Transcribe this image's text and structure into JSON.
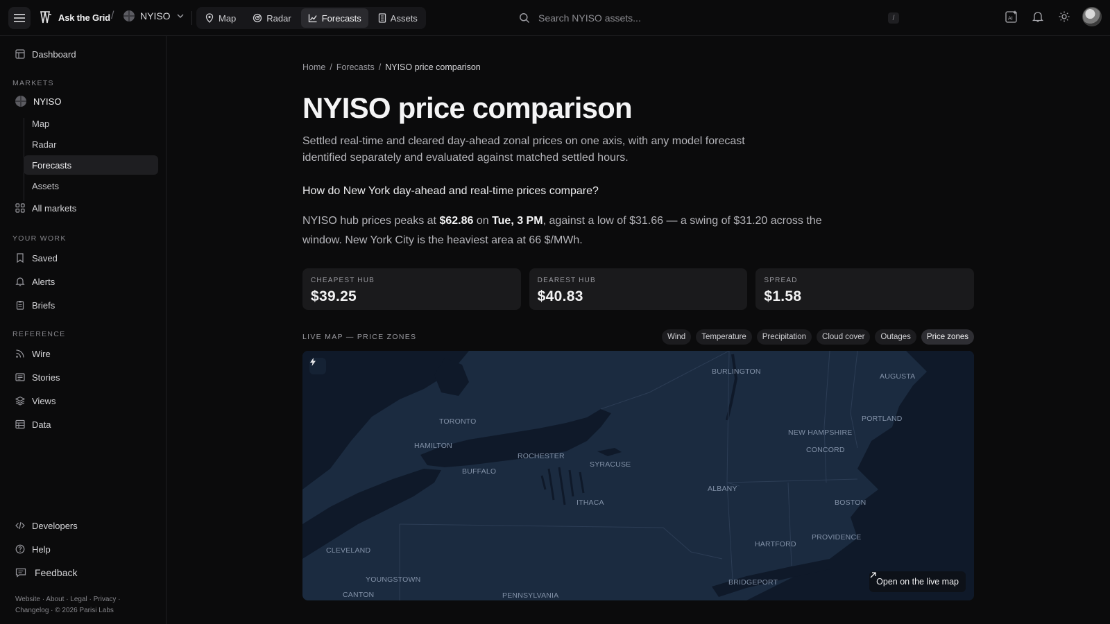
{
  "topbar": {
    "brand": "Ask the Grid",
    "separator": "/",
    "market": "NYISO",
    "tabs": [
      {
        "label": "Map",
        "icon": "map-pin-icon"
      },
      {
        "label": "Radar",
        "icon": "radar-icon"
      },
      {
        "label": "Forecasts",
        "icon": "chart-icon",
        "active": true
      },
      {
        "label": "Assets",
        "icon": "building-icon"
      }
    ],
    "search_placeholder": "Search NYISO assets...",
    "search_shortcut": "/"
  },
  "sidebar": {
    "dashboard": "Dashboard",
    "markets_heading": "MARKETS",
    "market_name": "NYISO",
    "market_subitems": [
      "Map",
      "Radar",
      "Forecasts",
      "Assets"
    ],
    "active_subitem": "Forecasts",
    "all_markets": "All markets",
    "your_work_heading": "YOUR WORK",
    "your_work": [
      "Saved",
      "Alerts",
      "Briefs"
    ],
    "reference_heading": "REFERENCE",
    "reference": [
      "Wire",
      "Stories",
      "Views",
      "Data"
    ],
    "developers": "Developers",
    "help": "Help",
    "feedback": "Feedback",
    "footer_line1": "Website · About · Legal · Privacy ·",
    "footer_line2": "Changelog · © 2026 Parisi Labs"
  },
  "main": {
    "breadcrumb": [
      "Home",
      "Forecasts",
      "NYISO price comparison"
    ],
    "breadcrumb_sep": "/",
    "title": "NYISO price comparison",
    "subtitle": "Settled real-time and cleared day-ahead zonal prices on one axis, with any model forecast identified separately and evaluated against matched settled hours.",
    "question": "How do New York day-ahead and real-time prices compare?",
    "summary": {
      "p1": "NYISO hub prices peaks at ",
      "peak": "$62.86",
      "p2": " on ",
      "peak_time": "Tue, 3 PM",
      "p3": ", against a low of $31.66 — a swing of $31.20 across the window. New York City is the heaviest area at 66 $/MWh."
    },
    "kpis": [
      {
        "label": "CHEAPEST HUB",
        "value": "$39.25"
      },
      {
        "label": "DEAREST HUB",
        "value": "$40.83"
      },
      {
        "label": "SPREAD",
        "value": "$1.58"
      }
    ],
    "map_label": "LIVE MAP — PRICE ZONES",
    "layers": [
      "Wind",
      "Temperature",
      "Precipitation",
      "Cloud cover",
      "Outages",
      "Price zones"
    ],
    "active_layer": "Price zones",
    "cities": [
      "BURLINGTON",
      "AUGUSTA",
      "TORONTO",
      "PORTLAND",
      "NEW HAMPSHIRE",
      "CONCORD",
      "HAMILTON",
      "ROCHESTER",
      "SYRACUSE",
      "BUFFALO",
      "ALBANY",
      "ITHACA",
      "BOSTON",
      "PROVIDENCE",
      "HARTFORD",
      "CLEVELAND",
      "YOUNGSTOWN",
      "BRIDGEPORT",
      "CANTON",
      "PENNSYLVANIA"
    ],
    "map_cta": "Open on the live map"
  },
  "colors": {
    "background": "#0b0b0c",
    "map_land": "#1b2b40",
    "map_water": "#0f1929",
    "accent_text": "#f4f4f5"
  }
}
